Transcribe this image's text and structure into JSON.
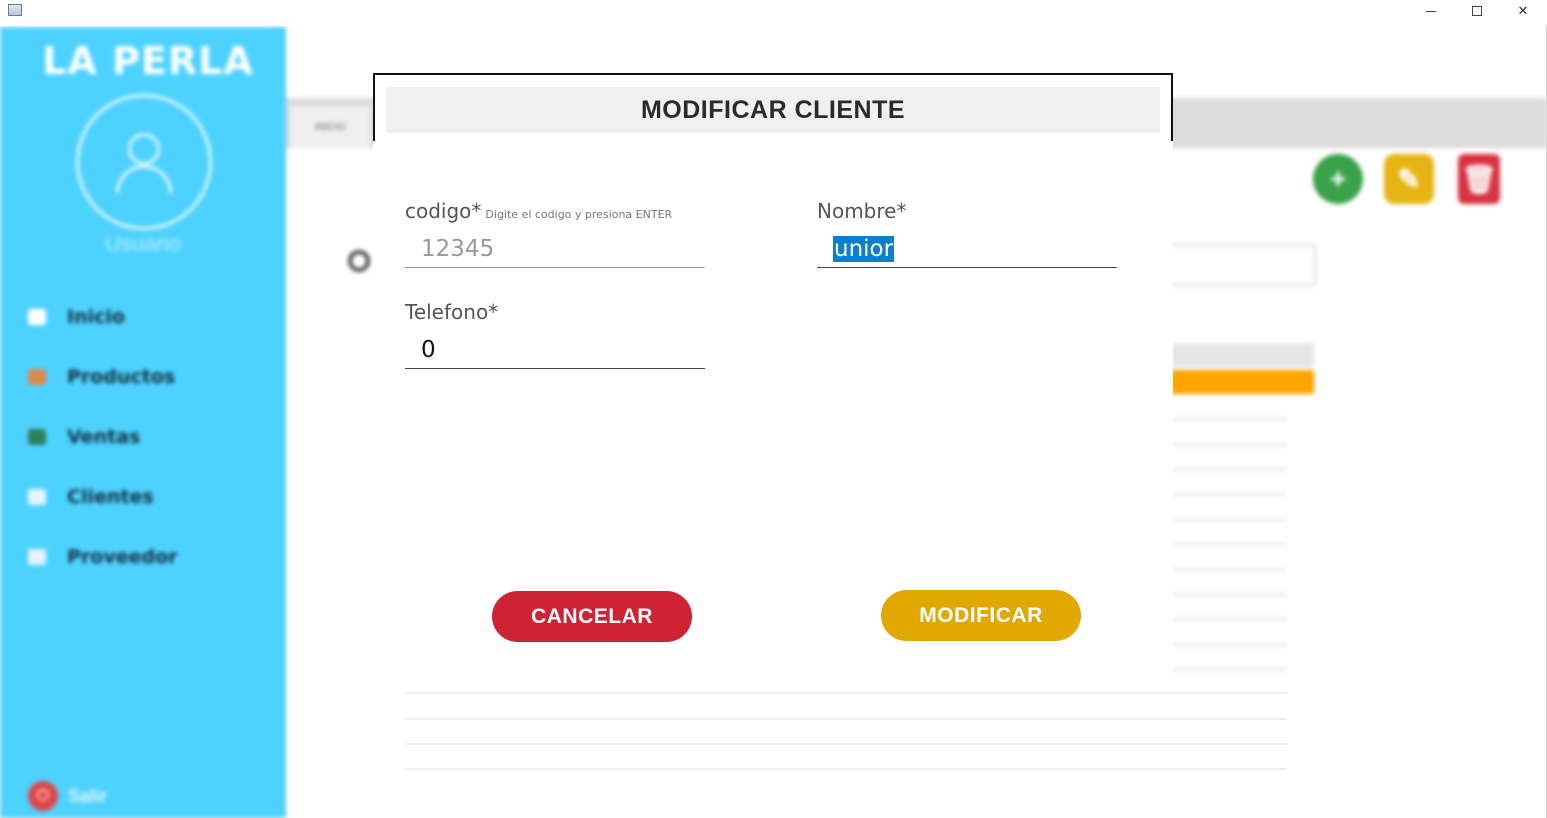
{
  "window": {
    "minimize": "—",
    "maximize": "☐",
    "close": "✕"
  },
  "sidebar": {
    "brand": "LA PERLA",
    "username": "Usuario",
    "items": [
      {
        "label": "Inicio",
        "icon": "home-icon",
        "color": "#ffffff"
      },
      {
        "label": "Productos",
        "icon": "box-icon",
        "color": "#e0884a"
      },
      {
        "label": "Ventas",
        "icon": "chart-icon",
        "color": "#2f7f5a"
      },
      {
        "label": "Clientes",
        "icon": "people-icon",
        "color": "#e8f4ff"
      },
      {
        "label": "Proveedor",
        "icon": "truck-icon",
        "color": "#e8f4ff"
      }
    ],
    "logout": "Salir"
  },
  "background": {
    "tab": "INICIO",
    "actions": {
      "add": "+",
      "edit": "✎",
      "delete": "🗑"
    }
  },
  "dialog": {
    "title": "MODIFICAR CLIENTE",
    "codigo": {
      "label": "codigo*",
      "hint": "Digite el codigo y presiona ENTER",
      "value": "12345"
    },
    "nombre": {
      "label": "Nombre*",
      "value": "unior"
    },
    "telefono": {
      "label": "Telefono*",
      "value": "0"
    },
    "cancel_label": "CANCELAR",
    "modify_label": "MODIFICAR"
  },
  "colors": {
    "sidebar": "#4dd2ff",
    "cancel": "#cf2333",
    "modify": "#e0a800",
    "selection": "#0f7fc7"
  }
}
